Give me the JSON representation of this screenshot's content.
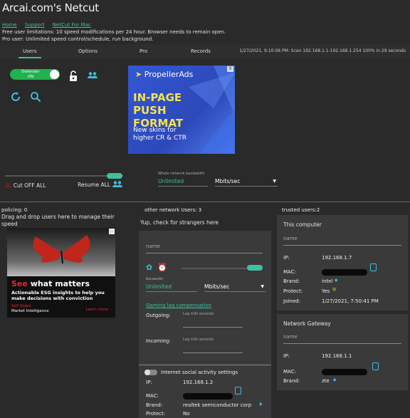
{
  "app": {
    "title": "Arcai.com's Netcut"
  },
  "links": [
    "Home",
    "Support",
    "NetCut For Mac"
  ],
  "info": {
    "free": "Free user limitations: 10 speed modifications per 24 hour. Browser needs to remain open.",
    "pro": "Pro user: Unlimited speed control/schedule, run background."
  },
  "tabs": [
    "Users",
    "Options",
    "Pro",
    "Records"
  ],
  "scan_status": "1/27/2021, 9:10:06 PM: Scan 192.168.1.1-192.168.1.254 100% in 29 seconds",
  "defender": {
    "label": "Defender",
    "state": "ON"
  },
  "ad1": {
    "brand": "PropellerAds",
    "headline": "IN-PAGE PUSH FORMAT",
    "sub": "New skins for higher CR & CTR",
    "close": "X"
  },
  "controls": {
    "cut_off": "Cut OFF ALL",
    "resume": "Resume ALL",
    "whole_bandwidth_label": "Whole network bandwidth",
    "bandwidth_value": "Unlimited",
    "bandwidth_unit": "Mbits/sec"
  },
  "policing": {
    "title": "policing: 0",
    "drag_hint": "Drag and drop users here to manage their speed"
  },
  "ad2": {
    "headline_a": "See",
    "headline_b": "what matters",
    "body": "Actionable ESG insights to help you make decisions with conviction",
    "brand_a": "S&P Global",
    "brand_b": "Market Intelligence",
    "cta": "Learn more ›"
  },
  "other": {
    "title": "other network Users: 3",
    "hint": "Yup, check for strangers here",
    "name_placeholder": "name",
    "bandwidth_label": "Bandwidth",
    "bandwidth_value": "Unlimited",
    "bandwidth_unit": "Mbits/sec",
    "gaming_label": "Gaming lag compensation",
    "outgoing_label": "Outgoing:",
    "incoming_label": "Incoming:",
    "lag_placeholder": "Lag milli seconds",
    "social_label": "Internet social activity settings",
    "ip_label": "IP:",
    "ip": "192.168.1.2",
    "mac_label": "MAC:",
    "brand_label": "Brand:",
    "brand": "realtek semiconductor corp",
    "protect_label": "Protect:",
    "protect": "No"
  },
  "trusted": {
    "title": "trusted users:2",
    "this_computer": {
      "title": "This computer",
      "name_placeholder": "name",
      "ip_label": "IP:",
      "ip": "192.168.1.7",
      "mac_label": "MAC:",
      "brand_label": "Brand:",
      "brand": "intel",
      "protect_label": "Protect:",
      "protect": "Yes",
      "joined_label": "Joined:",
      "joined": "1/27/2021, 7:50:41 PM"
    },
    "gateway": {
      "title": "Network Gateway",
      "name_placeholder": "name",
      "ip_label": "IP:",
      "ip": "192.168.1.1",
      "mac_label": "MAC:",
      "brand_label": "Brand:",
      "brand": "zte"
    }
  },
  "colors": {
    "accent": "#3fbf9f",
    "toggle_green": "#21b14e",
    "bg": "#2a2a2a",
    "panel": "#3a3a3a"
  }
}
